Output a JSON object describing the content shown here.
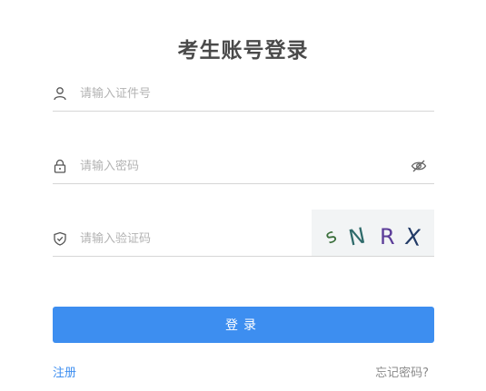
{
  "title": "考生账号登录",
  "form": {
    "id_field": {
      "value": "",
      "placeholder": "请输入证件号",
      "icon": "user-icon"
    },
    "password_field": {
      "value": "",
      "placeholder": "请输入密码",
      "icon": "lock-icon",
      "toggle_icon": "eye-off-icon"
    },
    "captcha_field": {
      "value": "",
      "placeholder": "请输入验证码",
      "icon": "shield-icon"
    },
    "captcha_image": {
      "chars": [
        "s",
        "N",
        "R",
        "X"
      ],
      "colors": [
        "#3a6e3a",
        "#2f6b6b",
        "#5c3d99",
        "#223a66"
      ]
    }
  },
  "login_button": {
    "label": "登录"
  },
  "links": {
    "register": "注册",
    "forgot_password": "忘记密码?"
  },
  "colors": {
    "accent": "#3d8ef0",
    "title": "#4a4a4a",
    "muted": "#8a8a8a"
  }
}
